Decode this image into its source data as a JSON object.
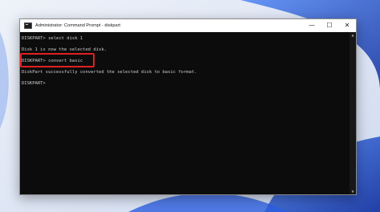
{
  "window": {
    "title": "Administrator: Command Prompt - diskpart",
    "minimize_glyph": "—",
    "maximize_glyph": "☐",
    "close_glyph": "✕"
  },
  "console": {
    "lines": [
      "DISKPART> select disk 1",
      "",
      "Disk 1 is now the selected disk.",
      "",
      "DISKPART> convert basic",
      "",
      "DiskPart successfully converted the selected disk to basic format.",
      "",
      "DISKPART> "
    ]
  },
  "icons": {
    "app": "command-prompt-icon",
    "scroll_up": "scroll-up-arrow-icon",
    "scroll_down": "scroll-down-arrow-icon"
  },
  "colors": {
    "console_background": "#0c0c0c",
    "console_text": "#cccccc",
    "highlight_box": "#e02020",
    "titlebar": "#ffffff",
    "wallpaper": "#dfe7f3",
    "wallpaper_accent": "#1f4fc9"
  }
}
